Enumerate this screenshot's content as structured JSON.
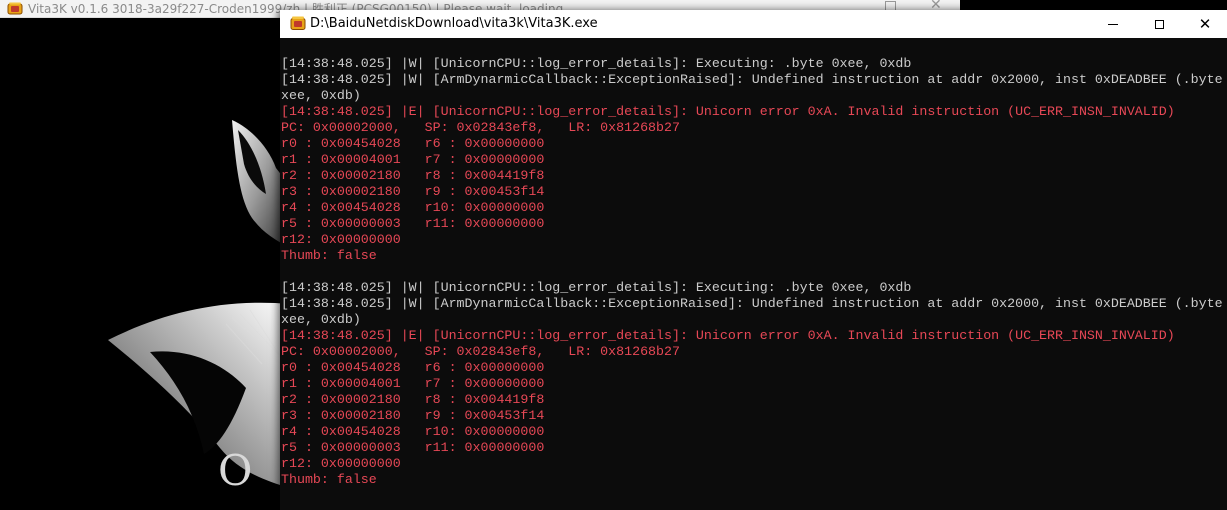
{
  "background_window": {
    "title": "Vita3K v0.1.6 3018-3a29f227-Croden1999/zh | 胜利正 (PCSG00150) | Please wait, loading...",
    "splash_letters": "O R"
  },
  "console_window": {
    "title": "D:\\BaiduNetdiskDownload\\vita3k\\Vita3K.exe",
    "controls": {
      "minimize": "minimize-icon",
      "maximize": "maximize-icon",
      "close_glyph": "✕"
    },
    "colors": {
      "background": "#0c0c0c",
      "text_warning": "#cccccc",
      "text_error": "#e74856"
    },
    "log_lines": [
      {
        "level": "w",
        "text": "[14:38:48.025] |W| [UnicornCPU::log_error_details]: Executing: .byte 0xee, 0xdb"
      },
      {
        "level": "w",
        "text": "[14:38:48.025] |W| [ArmDynarmicCallback::ExceptionRaised]: Undefined instruction at addr 0x2000, inst 0xDEADBEE (.byte"
      },
      {
        "level": "w",
        "text": "xee, 0xdb)"
      },
      {
        "level": "e",
        "text": "[14:38:48.025] |E| [UnicornCPU::log_error_details]: Unicorn error 0xA. Invalid instruction (UC_ERR_INSN_INVALID)"
      },
      {
        "level": "e",
        "text": "PC: 0x00002000,   SP: 0x02843ef8,   LR: 0x81268b27"
      },
      {
        "level": "e",
        "text": "r0 : 0x00454028   r6 : 0x00000000"
      },
      {
        "level": "e",
        "text": "r1 : 0x00004001   r7 : 0x00000000"
      },
      {
        "level": "e",
        "text": "r2 : 0x00002180   r8 : 0x004419f8"
      },
      {
        "level": "e",
        "text": "r3 : 0x00002180   r9 : 0x00453f14"
      },
      {
        "level": "e",
        "text": "r4 : 0x00454028   r10: 0x00000000"
      },
      {
        "level": "e",
        "text": "r5 : 0x00000003   r11: 0x00000000"
      },
      {
        "level": "e",
        "text": "r12: 0x00000000"
      },
      {
        "level": "e",
        "text": "Thumb: false"
      },
      {
        "level": "blank",
        "text": ""
      },
      {
        "level": "w",
        "text": "[14:38:48.025] |W| [UnicornCPU::log_error_details]: Executing: .byte 0xee, 0xdb"
      },
      {
        "level": "w",
        "text": "[14:38:48.025] |W| [ArmDynarmicCallback::ExceptionRaised]: Undefined instruction at addr 0x2000, inst 0xDEADBEE (.byte"
      },
      {
        "level": "w",
        "text": "xee, 0xdb)"
      },
      {
        "level": "e",
        "text": "[14:38:48.025] |E| [UnicornCPU::log_error_details]: Unicorn error 0xA. Invalid instruction (UC_ERR_INSN_INVALID)"
      },
      {
        "level": "e",
        "text": "PC: 0x00002000,   SP: 0x02843ef8,   LR: 0x81268b27"
      },
      {
        "level": "e",
        "text": "r0 : 0x00454028   r6 : 0x00000000"
      },
      {
        "level": "e",
        "text": "r1 : 0x00004001   r7 : 0x00000000"
      },
      {
        "level": "e",
        "text": "r2 : 0x00002180   r8 : 0x004419f8"
      },
      {
        "level": "e",
        "text": "r3 : 0x00002180   r9 : 0x00453f14"
      },
      {
        "level": "e",
        "text": "r4 : 0x00454028   r10: 0x00000000"
      },
      {
        "level": "e",
        "text": "r5 : 0x00000003   r11: 0x00000000"
      },
      {
        "level": "e",
        "text": "r12: 0x00000000"
      },
      {
        "level": "e",
        "text": "Thumb: false"
      }
    ]
  }
}
